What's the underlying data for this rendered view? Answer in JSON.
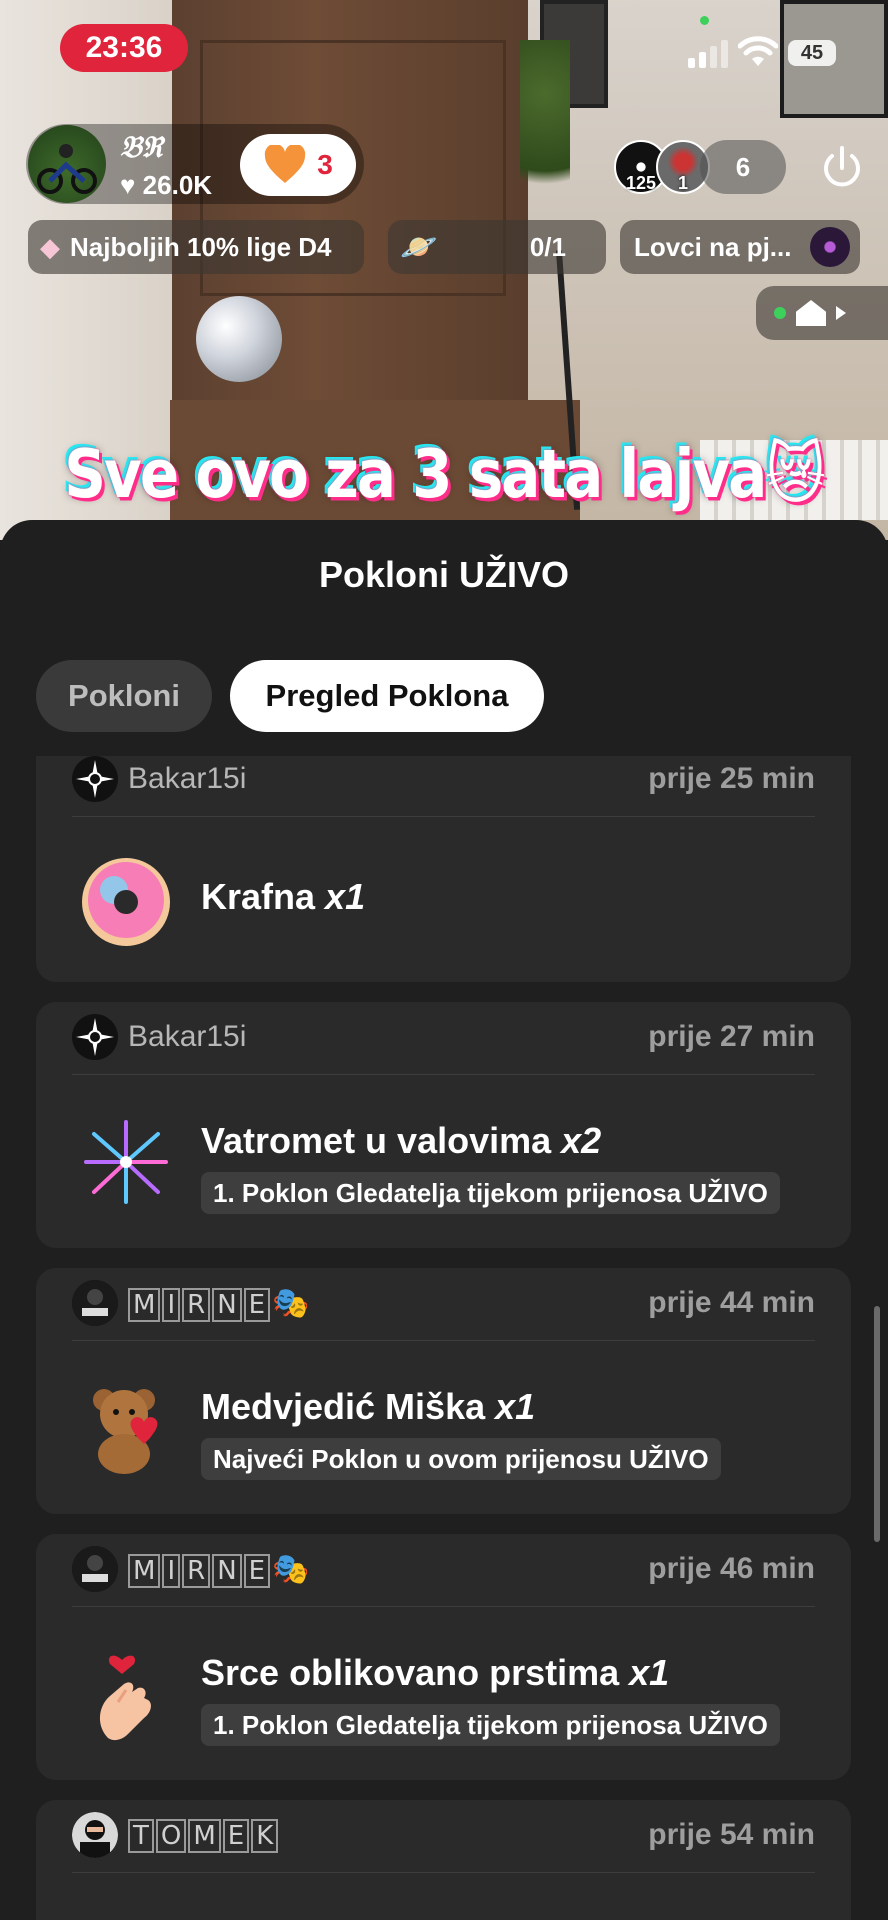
{
  "status_bar": {
    "time": "23:36",
    "battery": "45"
  },
  "host": {
    "name": "𝔅ℜ",
    "likes": "26.0K",
    "like_count": "3"
  },
  "viewers": {
    "avatar1_badge": "125",
    "avatar2_badge": "1",
    "count": "6"
  },
  "badges": {
    "rank": "Najboljih 10% lige D4",
    "planet_progress": "0/1",
    "hunters": "Lovci na pj..."
  },
  "video_caption": "Sve ovo za 3 sata lajva😿",
  "sheet": {
    "title": "Pokloni UŽIVO",
    "tabs": {
      "gifts": "Pokloni",
      "overview": "Pregled Poklona"
    }
  },
  "gifts": [
    {
      "sender": "Bakar15i",
      "time": "prije 25 min",
      "gift": "Krafna",
      "qty": "x1",
      "tag": ""
    },
    {
      "sender": "Bakar15i",
      "time": "prije 27 min",
      "gift": "Vatromet u valovima",
      "qty": "x2",
      "tag": "1. Poklon Gledatelja tijekom prijenosa UŽIVO"
    },
    {
      "sender": "MIRNE",
      "sender_emoji": "🎭",
      "time": "prije 44 min",
      "gift": "Medvjedić Miška",
      "qty": "x1",
      "tag": "Najveći Poklon u ovom prijenosu UŽIVO"
    },
    {
      "sender": "MIRNE",
      "sender_emoji": "🎭",
      "time": "prije 46 min",
      "gift": "Srce oblikovano prstima",
      "qty": "x1",
      "tag": "1. Poklon Gledatelja tijekom prijenosa UŽIVO"
    },
    {
      "sender": "TOMEK",
      "time": "prije 54 min",
      "gift": "",
      "qty": "",
      "tag": ""
    }
  ],
  "colors": {
    "live_red": "#e0243b",
    "sheet_bg": "#1f1f1f",
    "card_bg": "#2a2a2a",
    "tag_bg": "#3e3e3e"
  }
}
